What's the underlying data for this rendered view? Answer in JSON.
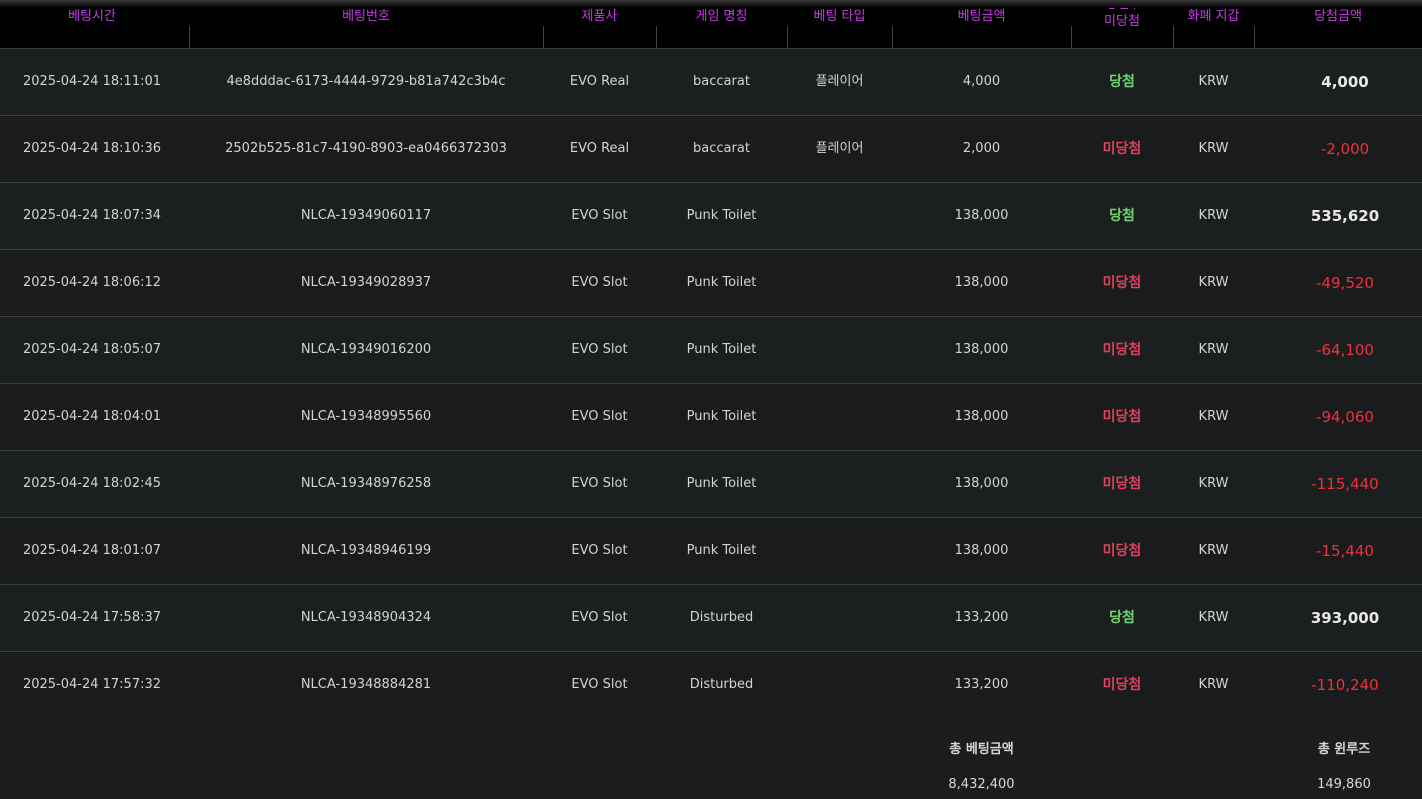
{
  "columns": {
    "bet_time": "베팅시간",
    "bet_id": "베팅번호",
    "provider": "제품사",
    "game_name": "게임 명칭",
    "bet_type": "베팅 타입",
    "bet_amount": "베팅금액",
    "result_line1": "당첨 /",
    "result_line2": "미당첨",
    "currency": "화폐 지갑",
    "payout": "당첨금액"
  },
  "rows": [
    {
      "time": "2025-04-24 18:11:01",
      "id": "4e8dddac-6173-4444-9729-b81a742c3b4c",
      "provider": "EVO Real",
      "game": "baccarat",
      "type": "플레이어",
      "amount": "4,000",
      "result": "당첨",
      "currency": "KRW",
      "payout": "4,000"
    },
    {
      "time": "2025-04-24 18:10:36",
      "id": "2502b525-81c7-4190-8903-ea0466372303",
      "provider": "EVO Real",
      "game": "baccarat",
      "type": "플레이어",
      "amount": "2,000",
      "result": "미당첨",
      "currency": "KRW",
      "payout": "-2,000"
    },
    {
      "time": "2025-04-24 18:07:34",
      "id": "NLCA-19349060117",
      "provider": "EVO Slot",
      "game": "Punk Toilet",
      "type": "",
      "amount": "138,000",
      "result": "당첨",
      "currency": "KRW",
      "payout": "535,620"
    },
    {
      "time": "2025-04-24 18:06:12",
      "id": "NLCA-19349028937",
      "provider": "EVO Slot",
      "game": "Punk Toilet",
      "type": "",
      "amount": "138,000",
      "result": "미당첨",
      "currency": "KRW",
      "payout": "-49,520"
    },
    {
      "time": "2025-04-24 18:05:07",
      "id": "NLCA-19349016200",
      "provider": "EVO Slot",
      "game": "Punk Toilet",
      "type": "",
      "amount": "138,000",
      "result": "미당첨",
      "currency": "KRW",
      "payout": "-64,100"
    },
    {
      "time": "2025-04-24 18:04:01",
      "id": "NLCA-19348995560",
      "provider": "EVO Slot",
      "game": "Punk Toilet",
      "type": "",
      "amount": "138,000",
      "result": "미당첨",
      "currency": "KRW",
      "payout": "-94,060"
    },
    {
      "time": "2025-04-24 18:02:45",
      "id": "NLCA-19348976258",
      "provider": "EVO Slot",
      "game": "Punk Toilet",
      "type": "",
      "amount": "138,000",
      "result": "미당첨",
      "currency": "KRW",
      "payout": "-115,440"
    },
    {
      "time": "2025-04-24 18:01:07",
      "id": "NLCA-19348946199",
      "provider": "EVO Slot",
      "game": "Punk Toilet",
      "type": "",
      "amount": "138,000",
      "result": "미당첨",
      "currency": "KRW",
      "payout": "-15,440"
    },
    {
      "time": "2025-04-24 17:58:37",
      "id": "NLCA-19348904324",
      "provider": "EVO Slot",
      "game": "Disturbed",
      "type": "",
      "amount": "133,200",
      "result": "당첨",
      "currency": "KRW",
      "payout": "393,000"
    },
    {
      "time": "2025-04-24 17:57:32",
      "id": "NLCA-19348884281",
      "provider": "EVO Slot",
      "game": "Disturbed",
      "type": "",
      "amount": "133,200",
      "result": "미당첨",
      "currency": "KRW",
      "payout": "-110,240"
    }
  ],
  "summary": {
    "total_bet_label": "총 베팅금액",
    "total_bet_value": "8,432,400",
    "total_winloss_label": "총 윈루즈",
    "total_winloss_value": "149,860"
  },
  "colors": {
    "header_text": "#c53ce6",
    "win": "#6dd66d",
    "lose": "#e0415a",
    "negative_payout": "#f0303a"
  }
}
